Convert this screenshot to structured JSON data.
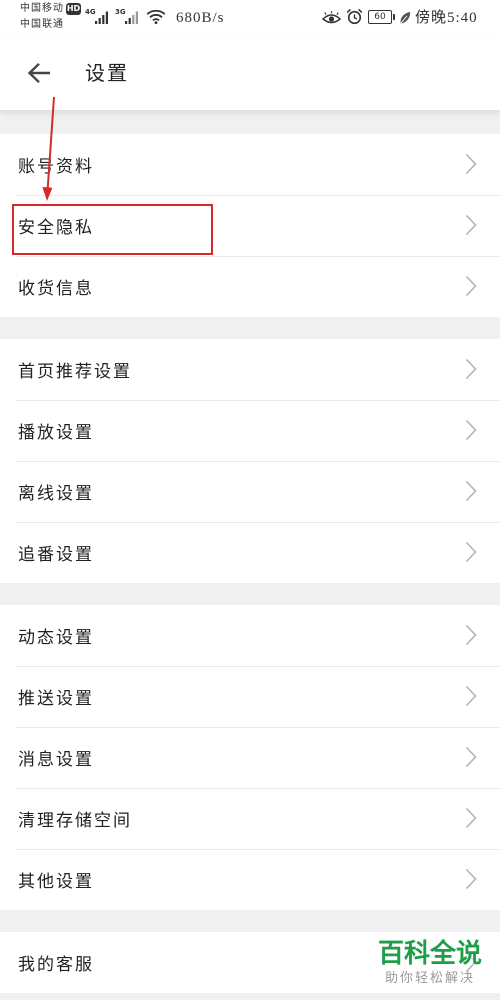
{
  "status_bar": {
    "carrier_primary": "中国移动",
    "hd_badge": "HD",
    "carrier_secondary": "中国联通",
    "network_primary": "4G",
    "network_secondary": "3G",
    "network_speed": "680B/s",
    "battery_level": "60",
    "time": "傍晚5:40",
    "icons": [
      "signal-bars-icon",
      "wifi-icon",
      "eye-icon",
      "alarm-icon",
      "battery-icon",
      "leaf-icon"
    ]
  },
  "header": {
    "back_icon": "back-arrow-icon",
    "title": "设置"
  },
  "row_icon": "chevron-right-icon",
  "groups": [
    {
      "items": [
        {
          "label": "账号资料"
        },
        {
          "label": "安全隐私",
          "highlighted": true
        },
        {
          "label": "收货信息"
        }
      ]
    },
    {
      "items": [
        {
          "label": "首页推荐设置"
        },
        {
          "label": "播放设置"
        },
        {
          "label": "离线设置"
        },
        {
          "label": "追番设置"
        }
      ]
    },
    {
      "items": [
        {
          "label": "动态设置"
        },
        {
          "label": "推送设置"
        },
        {
          "label": "消息设置"
        },
        {
          "label": "清理存储空间"
        },
        {
          "label": "其他设置"
        }
      ]
    },
    {
      "items": [
        {
          "label": "我的客服"
        }
      ]
    }
  ],
  "annotation": {
    "arrow_icon": "red-arrow-down-icon"
  },
  "watermark": {
    "brand": "百科全说",
    "slogan": "助你轻松解决"
  },
  "colors": {
    "bg": "#f0f0f0",
    "surface": "#ffffff",
    "text": "#222222",
    "divider": "#e9e9e9",
    "chevron": "#b3b3b3",
    "annotation": "#d42a2a",
    "wm-brand": "#1f9e4a",
    "wm-slogan": "#9a9a9a"
  }
}
